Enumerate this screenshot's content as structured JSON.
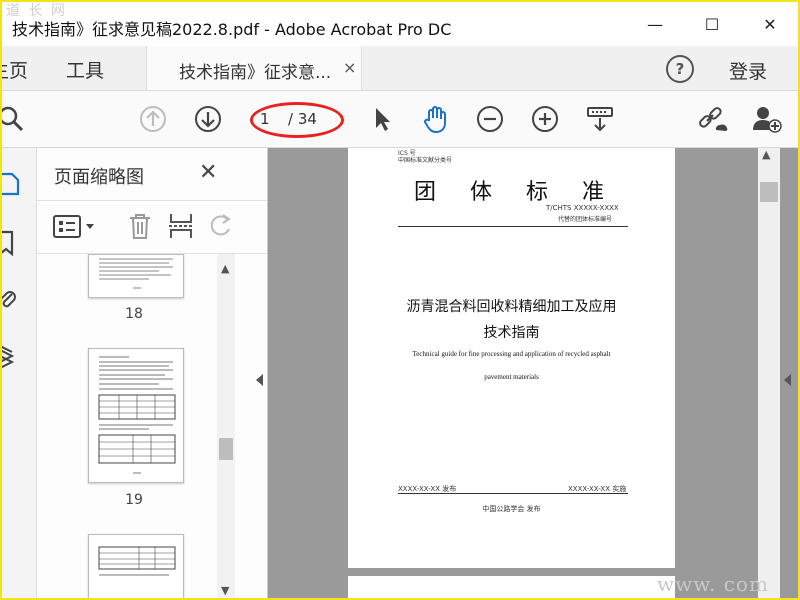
{
  "window": {
    "title": "技术指南》征求意见稿2022.8.pdf - Adobe Acrobat Pro DC",
    "watermark_top": "道 长 网",
    "minimize": "—",
    "maximize": "☐",
    "close": "✕"
  },
  "menu": {
    "home": "主页",
    "tools": "工具",
    "doc_tab": "技术指南》征求意...",
    "doc_tab_close": "×",
    "help": "?",
    "login": "登录"
  },
  "toolbar": {
    "page_current": "1",
    "page_total": "/ 34"
  },
  "panel": {
    "title": "页面缩略图",
    "close": "✕",
    "thumbnails": [
      {
        "number": "18"
      },
      {
        "number": "19"
      }
    ]
  },
  "document": {
    "top_label": "ICS 号",
    "class_label": "中国标准文献分类号",
    "heading": "团　体　标　准",
    "std_number": "T/CHTS XXXXX-XXXX",
    "replaced": "代替的团体标准编号",
    "title_cn_line1": "沥青混合料回收料精细加工及应用",
    "title_cn_line2": "技术指南",
    "title_en_line1": "Technical guide for fine processing and application of recycled asphalt",
    "title_en_line2": "pavement materials",
    "publish_date": "XXXX-XX-XX 发布",
    "implement_date": "XXXX-XX-XX 实施",
    "publisher": "中国公路学会  发布"
  },
  "watermark_bottom": "www.          com",
  "colors": {
    "frame": "#f2e31a",
    "highlight_oval": "#e8221f",
    "hand_tool": "#1a73c9"
  }
}
